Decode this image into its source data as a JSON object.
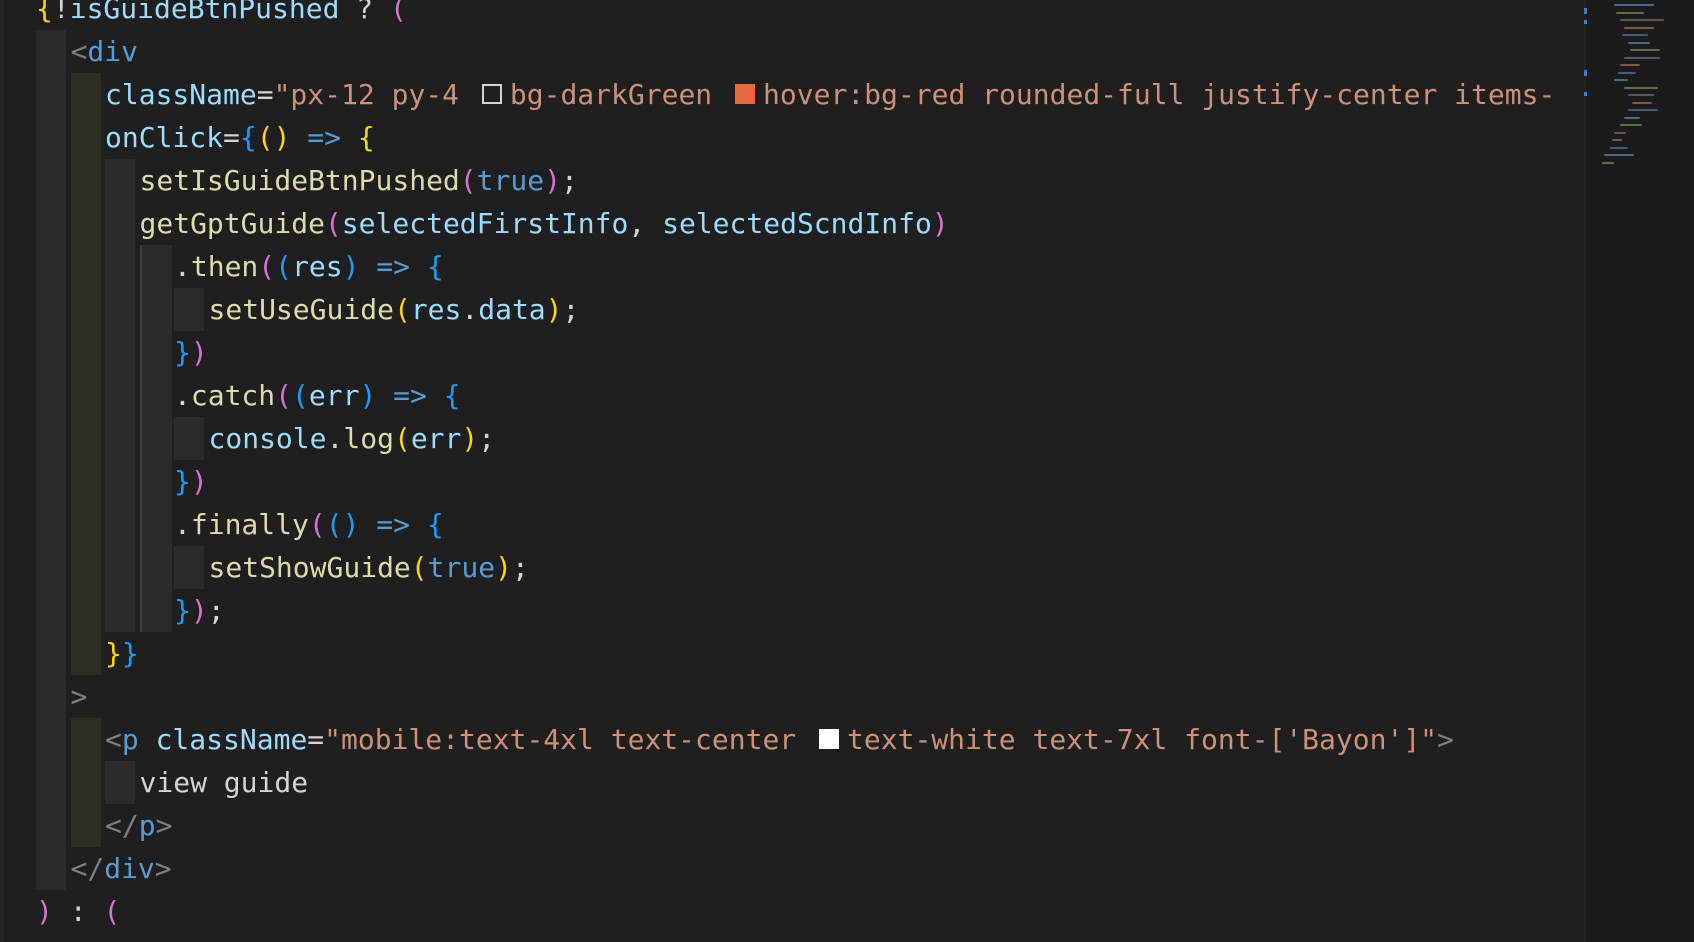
{
  "theme": {
    "background": "#1f1f1f",
    "colors": {
      "plain": "#d4d4d4",
      "tag": "#569cd6",
      "punct": "#808080",
      "attr": "#9cdcfe",
      "string": "#ce9178",
      "func": "#dcdcaa",
      "bool": "#569cd6",
      "var": "#9cdcfe",
      "bracket_gold": "#ffd700",
      "bracket_pink": "#da70d6",
      "bracket_blue": "#179fff",
      "text_content": "#d4d4d4"
    },
    "swatches": {
      "darkGreen": "#1f1f1f",
      "red": "#e86a3c",
      "white": "#ffffff"
    }
  },
  "lines": [
    {
      "indent": 1,
      "guides": [],
      "tokens": [
        {
          "t": "{",
          "c": "bracket_gold"
        },
        {
          "t": "!",
          "c": "plain"
        },
        {
          "t": "isGuideBtnPushed",
          "c": "var"
        },
        {
          "t": " ? ",
          "c": "plain"
        },
        {
          "t": "(",
          "c": "bracket_pink"
        }
      ]
    },
    {
      "indent": 2,
      "guides": [
        "gray"
      ],
      "tokens": [
        {
          "t": "<",
          "c": "punct"
        },
        {
          "t": "div",
          "c": "tag"
        }
      ]
    },
    {
      "indent": 3,
      "guides": [
        "gray",
        "tan"
      ],
      "tokens": [
        {
          "t": "className",
          "c": "attr"
        },
        {
          "t": "=",
          "c": "plain"
        },
        {
          "t": "\"px-12 py-4 ",
          "c": "string"
        },
        {
          "swatch": "darkGreen",
          "outline": true
        },
        {
          "t": "bg-darkGreen ",
          "c": "string"
        },
        {
          "swatch": "red"
        },
        {
          "t": "hover:bg-red rounded-full justify-center items-",
          "c": "string"
        }
      ]
    },
    {
      "indent": 3,
      "guides": [
        "gray",
        "tan"
      ],
      "tokens": [
        {
          "t": "onClick",
          "c": "attr"
        },
        {
          "t": "=",
          "c": "plain"
        },
        {
          "t": "{",
          "c": "bracket_blue"
        },
        {
          "t": "()",
          "c": "bracket_gold"
        },
        {
          "t": " => ",
          "c": "tag"
        },
        {
          "t": "{",
          "c": "bracket_gold"
        }
      ]
    },
    {
      "indent": 4,
      "guides": [
        "gray",
        "tan",
        "gray"
      ],
      "tokens": [
        {
          "t": "setIsGuideBtnPushed",
          "c": "func"
        },
        {
          "t": "(",
          "c": "bracket_pink"
        },
        {
          "t": "true",
          "c": "bool"
        },
        {
          "t": ")",
          "c": "bracket_pink"
        },
        {
          "t": ";",
          "c": "plain"
        }
      ]
    },
    {
      "indent": 4,
      "guides": [
        "gray",
        "tan",
        "gray"
      ],
      "tokens": [
        {
          "t": "getGptGuide",
          "c": "func"
        },
        {
          "t": "(",
          "c": "bracket_pink"
        },
        {
          "t": "selectedFirstInfo",
          "c": "var"
        },
        {
          "t": ", ",
          "c": "plain"
        },
        {
          "t": "selectedScndInfo",
          "c": "var"
        },
        {
          "t": ")",
          "c": "bracket_pink"
        }
      ]
    },
    {
      "indent": 5,
      "guides": [
        "gray",
        "tan",
        "gray",
        "border"
      ],
      "tokens": [
        {
          "t": ".",
          "c": "plain"
        },
        {
          "t": "then",
          "c": "func"
        },
        {
          "t": "(",
          "c": "bracket_pink"
        },
        {
          "t": "(",
          "c": "bracket_blue"
        },
        {
          "t": "res",
          "c": "var"
        },
        {
          "t": ")",
          "c": "bracket_blue"
        },
        {
          "t": " => ",
          "c": "tag"
        },
        {
          "t": "{",
          "c": "bracket_blue"
        }
      ]
    },
    {
      "indent": 6,
      "guides": [
        "gray",
        "tan",
        "gray",
        "border",
        "gray"
      ],
      "tokens": [
        {
          "t": "setUseGuide",
          "c": "func"
        },
        {
          "t": "(",
          "c": "bracket_gold"
        },
        {
          "t": "res",
          "c": "var"
        },
        {
          "t": ".",
          "c": "plain"
        },
        {
          "t": "data",
          "c": "var"
        },
        {
          "t": ")",
          "c": "bracket_gold"
        },
        {
          "t": ";",
          "c": "plain"
        }
      ]
    },
    {
      "indent": 5,
      "guides": [
        "gray",
        "tan",
        "gray",
        "border"
      ],
      "tokens": [
        {
          "t": "}",
          "c": "bracket_blue"
        },
        {
          "t": ")",
          "c": "bracket_pink"
        }
      ]
    },
    {
      "indent": 5,
      "guides": [
        "gray",
        "tan",
        "gray",
        "border"
      ],
      "tokens": [
        {
          "t": ".",
          "c": "plain"
        },
        {
          "t": "catch",
          "c": "func"
        },
        {
          "t": "(",
          "c": "bracket_pink"
        },
        {
          "t": "(",
          "c": "bracket_blue"
        },
        {
          "t": "err",
          "c": "var"
        },
        {
          "t": ")",
          "c": "bracket_blue"
        },
        {
          "t": " => ",
          "c": "tag"
        },
        {
          "t": "{",
          "c": "bracket_blue"
        }
      ]
    },
    {
      "indent": 6,
      "guides": [
        "gray",
        "tan",
        "gray",
        "border",
        "gray"
      ],
      "tokens": [
        {
          "t": "console",
          "c": "var"
        },
        {
          "t": ".",
          "c": "plain"
        },
        {
          "t": "log",
          "c": "func"
        },
        {
          "t": "(",
          "c": "bracket_gold"
        },
        {
          "t": "err",
          "c": "var"
        },
        {
          "t": ")",
          "c": "bracket_gold"
        },
        {
          "t": ";",
          "c": "plain"
        }
      ]
    },
    {
      "indent": 5,
      "guides": [
        "gray",
        "tan",
        "gray",
        "border"
      ],
      "tokens": [
        {
          "t": "}",
          "c": "bracket_blue"
        },
        {
          "t": ")",
          "c": "bracket_pink"
        }
      ]
    },
    {
      "indent": 5,
      "guides": [
        "gray",
        "tan",
        "gray",
        "border"
      ],
      "tokens": [
        {
          "t": ".",
          "c": "plain"
        },
        {
          "t": "finally",
          "c": "func"
        },
        {
          "t": "(",
          "c": "bracket_pink"
        },
        {
          "t": "()",
          "c": "bracket_blue"
        },
        {
          "t": " => ",
          "c": "tag"
        },
        {
          "t": "{",
          "c": "bracket_blue"
        }
      ]
    },
    {
      "indent": 6,
      "guides": [
        "gray",
        "tan",
        "gray",
        "border",
        "gray"
      ],
      "tokens": [
        {
          "t": "setShowGuide",
          "c": "func"
        },
        {
          "t": "(",
          "c": "bracket_gold"
        },
        {
          "t": "true",
          "c": "bool"
        },
        {
          "t": ")",
          "c": "bracket_gold"
        },
        {
          "t": ";",
          "c": "plain"
        }
      ]
    },
    {
      "indent": 5,
      "guides": [
        "gray",
        "tan",
        "gray",
        "border"
      ],
      "tokens": [
        {
          "t": "}",
          "c": "bracket_blue"
        },
        {
          "t": ")",
          "c": "bracket_pink"
        },
        {
          "t": ";",
          "c": "plain"
        }
      ]
    },
    {
      "indent": 3,
      "guides": [
        "gray",
        "tan"
      ],
      "tokens": [
        {
          "t": "}",
          "c": "bracket_gold"
        },
        {
          "t": "}",
          "c": "bracket_blue"
        }
      ]
    },
    {
      "indent": 2,
      "guides": [
        "gray"
      ],
      "tokens": [
        {
          "t": ">",
          "c": "punct"
        }
      ]
    },
    {
      "indent": 3,
      "guides": [
        "gray",
        "tan"
      ],
      "tokens": [
        {
          "t": "<",
          "c": "punct"
        },
        {
          "t": "p",
          "c": "tag"
        },
        {
          "t": " ",
          "c": "plain"
        },
        {
          "t": "className",
          "c": "attr"
        },
        {
          "t": "=",
          "c": "plain"
        },
        {
          "t": "\"mobile:text-4xl text-center ",
          "c": "string"
        },
        {
          "swatch": "white"
        },
        {
          "t": "text-white text-7xl font-['Bayon']\"",
          "c": "string"
        },
        {
          "t": ">",
          "c": "punct"
        }
      ]
    },
    {
      "indent": 4,
      "guides": [
        "gray",
        "tan",
        "gray"
      ],
      "tokens": [
        {
          "t": "view guide",
          "c": "text_content"
        }
      ]
    },
    {
      "indent": 3,
      "guides": [
        "gray",
        "tan"
      ],
      "tokens": [
        {
          "t": "</",
          "c": "punct"
        },
        {
          "t": "p",
          "c": "tag"
        },
        {
          "t": ">",
          "c": "punct"
        }
      ]
    },
    {
      "indent": 2,
      "guides": [
        "gray"
      ],
      "tokens": [
        {
          "t": "</",
          "c": "punct"
        },
        {
          "t": "div",
          "c": "tag"
        },
        {
          "t": ">",
          "c": "punct"
        }
      ]
    },
    {
      "indent": 1,
      "guides": [],
      "tokens": [
        {
          "t": ")",
          "c": "bracket_pink"
        },
        {
          "t": " : ",
          "c": "plain"
        },
        {
          "t": "(",
          "c": "bracket_pink"
        }
      ]
    }
  ]
}
